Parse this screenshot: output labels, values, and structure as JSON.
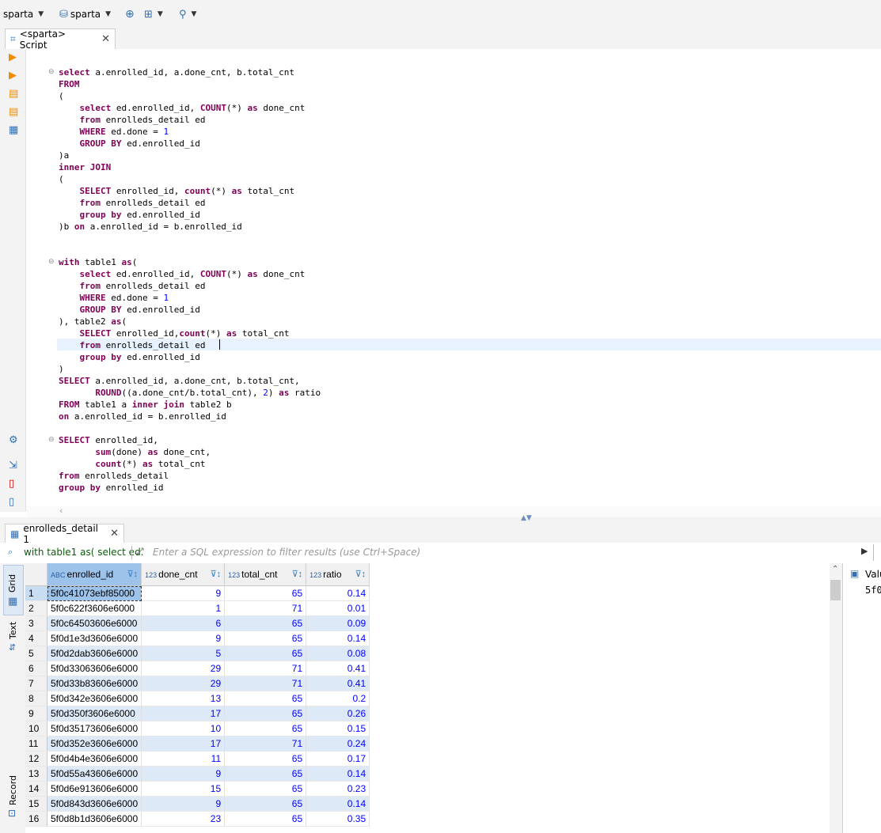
{
  "toolbar": {
    "connection": "sparta",
    "database": "sparta"
  },
  "editor_tab": {
    "title": "<sparta> Script"
  },
  "code_lines": [
    "select a.enrolled_id, a.done_cnt, b.total_cnt",
    "FROM",
    "(",
    "    select ed.enrolled_id, COUNT(*) as done_cnt",
    "    from enrolleds_detail ed",
    "    WHERE ed.done = 1",
    "    GROUP BY ed.enrolled_id",
    ")a",
    "inner JOIN",
    "(",
    "    SELECT enrolled_id, count(*) as total_cnt",
    "    from enrolleds_detail ed",
    "    group by ed.enrolled_id",
    ")b on a.enrolled_id = b.enrolled_id",
    "",
    "",
    "with table1 as(",
    "    select ed.enrolled_id, COUNT(*) as done_cnt",
    "    from enrolleds_detail ed",
    "    WHERE ed.done = 1",
    "    GROUP BY ed.enrolled_id",
    "), table2 as(",
    "    SELECT enrolled_id,count(*) as total_cnt",
    "    from enrolleds_detail ed ",
    "    group by ed.enrolled_id",
    ")",
    "SELECT a.enrolled_id, a.done_cnt, b.total_cnt,",
    "       ROUND((a.done_cnt/b.total_cnt), 2) as ratio",
    "FROM table1 a inner join table2 b",
    "on a.enrolled_id = b.enrolled_id",
    "",
    "SELECT enrolled_id,",
    "       sum(done) as done_cnt,",
    "       count(*) as total_cnt",
    "from enrolleds_detail",
    "group by enrolled_id"
  ],
  "results_tab": {
    "title": "enrolleds_detail 1"
  },
  "filter": {
    "query_label": "with table1 as( select ed.",
    "placeholder": "Enter a SQL expression to filter results (use Ctrl+Space)"
  },
  "side_tabs": {
    "grid": "Grid",
    "text": "Text",
    "record": "Record"
  },
  "columns": [
    {
      "name": "enrolled_id",
      "type": "ABC"
    },
    {
      "name": "done_cnt",
      "type": "123"
    },
    {
      "name": "total_cnt",
      "type": "123"
    },
    {
      "name": "ratio",
      "type": "123"
    }
  ],
  "rows": [
    {
      "n": "1",
      "id": "5f0c41073ebf85000",
      "done": "9",
      "total": "65",
      "ratio": "0.14"
    },
    {
      "n": "2",
      "id": "5f0c622f3606e6000",
      "done": "1",
      "total": "71",
      "ratio": "0.01"
    },
    {
      "n": "3",
      "id": "5f0c64503606e6000",
      "done": "6",
      "total": "65",
      "ratio": "0.09"
    },
    {
      "n": "4",
      "id": "5f0d1e3d3606e6000",
      "done": "9",
      "total": "65",
      "ratio": "0.14"
    },
    {
      "n": "5",
      "id": "5f0d2dab3606e6000",
      "done": "5",
      "total": "65",
      "ratio": "0.08"
    },
    {
      "n": "6",
      "id": "5f0d33063606e6000",
      "done": "29",
      "total": "71",
      "ratio": "0.41"
    },
    {
      "n": "7",
      "id": "5f0d33b83606e6000",
      "done": "29",
      "total": "71",
      "ratio": "0.41"
    },
    {
      "n": "8",
      "id": "5f0d342e3606e6000",
      "done": "13",
      "total": "65",
      "ratio": "0.2"
    },
    {
      "n": "9",
      "id": "5f0d350f3606e6000",
      "done": "17",
      "total": "65",
      "ratio": "0.26"
    },
    {
      "n": "10",
      "id": "5f0d35173606e6000",
      "done": "10",
      "total": "65",
      "ratio": "0.15"
    },
    {
      "n": "11",
      "id": "5f0d352e3606e6000",
      "done": "17",
      "total": "71",
      "ratio": "0.24"
    },
    {
      "n": "12",
      "id": "5f0d4b4e3606e6000",
      "done": "11",
      "total": "65",
      "ratio": "0.17"
    },
    {
      "n": "13",
      "id": "5f0d55a43606e6000",
      "done": "9",
      "total": "65",
      "ratio": "0.14"
    },
    {
      "n": "14",
      "id": "5f0d6e913606e6000",
      "done": "15",
      "total": "65",
      "ratio": "0.23"
    },
    {
      "n": "15",
      "id": "5f0d843d3606e6000",
      "done": "9",
      "total": "65",
      "ratio": "0.14"
    },
    {
      "n": "16",
      "id": "5f0d8b1d3606e6000",
      "done": "23",
      "total": "65",
      "ratio": "0.35"
    }
  ],
  "value_panel": {
    "title": "Valu",
    "value": "5f0"
  },
  "colors": {
    "keyword": "#7f0055",
    "selected_cell": "#9dc3ea",
    "alt_row": "#dde9f6"
  }
}
